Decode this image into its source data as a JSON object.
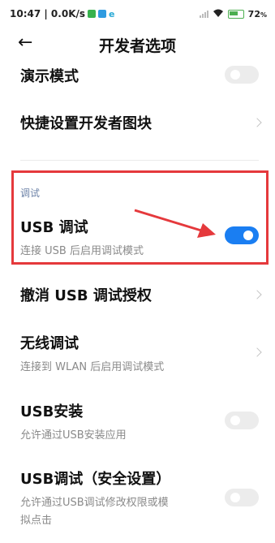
{
  "status_bar": {
    "time_speed": "10:47 | 0.0K/s",
    "battery": "72"
  },
  "header": {
    "back_icon": "back-arrow-icon",
    "title": "开发者选项"
  },
  "settings": {
    "demo_mode": {
      "title": "演示模式",
      "enabled": false
    },
    "quick_tiles": {
      "title": "快捷设置开发者图块"
    },
    "section_debug": "调试",
    "usb_debug": {
      "title": "USB 调试",
      "subtitle": "连接 USB 后启用调试模式",
      "enabled": true
    },
    "revoke_usb": {
      "title": "撤消 USB 调试授权"
    },
    "wireless_debug": {
      "title": "无线调试",
      "subtitle": "连接到 WLAN 后启用调试模式"
    },
    "usb_install": {
      "title": "USB安装",
      "subtitle": "允许通过USB安装应用",
      "enabled": false
    },
    "usb_debug_security": {
      "title": "USB调试（安全设置）",
      "subtitle_line1": "允许通过USB调试修改权限或模",
      "subtitle_line2": "拟点击",
      "enabled": false
    }
  },
  "colors": {
    "accent": "#1a7ef2",
    "highlight": "#e5393c"
  }
}
